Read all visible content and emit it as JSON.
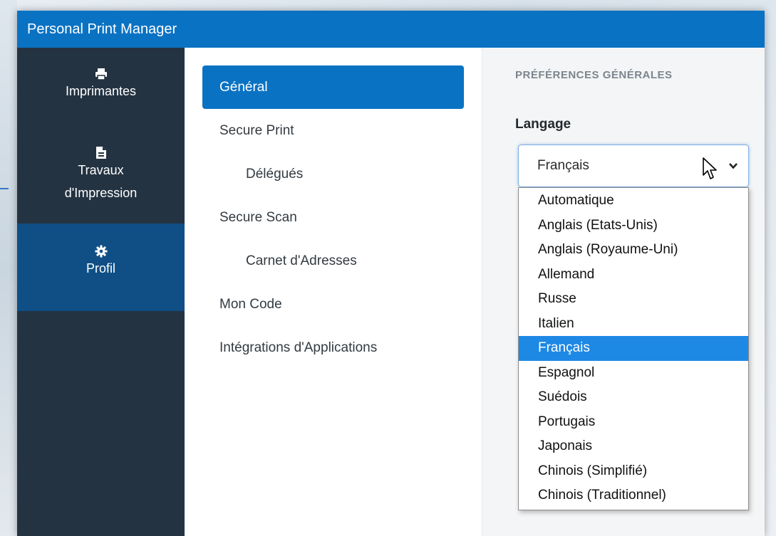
{
  "app": {
    "title": "Personal Print Manager"
  },
  "sidebar": {
    "items": [
      {
        "label": "Imprimantes",
        "icon": "printer-icon",
        "active": false
      },
      {
        "label_line1": "Travaux",
        "label_line2": "d'Impression",
        "icon": "document-icon",
        "active": false
      },
      {
        "label": "Profil",
        "icon": "gear-icon",
        "active": true
      }
    ]
  },
  "submenu": {
    "items": [
      {
        "label": "Général",
        "active": true
      },
      {
        "label": "Secure Print"
      },
      {
        "label": "Délégués"
      },
      {
        "label": "Secure Scan"
      },
      {
        "label": "Carnet d'Adresses"
      },
      {
        "label": "Mon Code"
      },
      {
        "label": "Intégrations d'Applications"
      }
    ]
  },
  "content": {
    "section_title": "PRÉFÉRENCES GÉNÉRALES",
    "language": {
      "label": "Langage",
      "selected": "Français",
      "options": [
        "Automatique",
        "Anglais (Etats-Unis)",
        "Anglais (Royaume-Uni)",
        "Allemand",
        "Russe",
        "Italien",
        "Français",
        "Espagnol",
        "Suédois",
        "Portugais",
        "Japonais",
        "Chinois (Simplifié)",
        "Chinois (Traditionnel)"
      ],
      "highlighted_index": 6
    }
  },
  "colors": {
    "titlebar": "#0a72c3",
    "sidebar": "#243342",
    "sidebar_active": "#0f4f86",
    "accent": "#0a72c3",
    "option_highlight": "#1e88e5"
  }
}
